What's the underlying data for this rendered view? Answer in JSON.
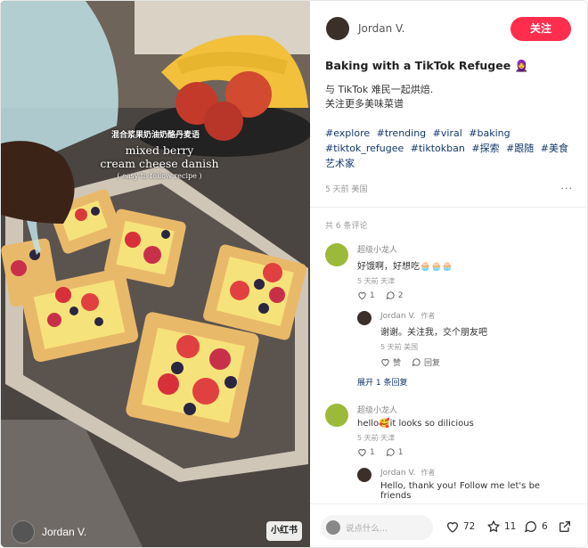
{
  "media": {
    "overlay_cn": "混合浆果奶油奶酪丹麦语",
    "overlay_title_line1": "mixed berry",
    "overlay_title_line2": "cream cheese danish",
    "overlay_subtitle": "( easy to follow recipe )",
    "author_name": "Jordan V.",
    "watermark": "小红书"
  },
  "header": {
    "author_name": "Jordan V.",
    "follow_label": "关注"
  },
  "post": {
    "title": "Baking with a TikTok Refugee 🧕",
    "desc_line1": "与 TikTok 难民一起烘焙.",
    "desc_line2": "关注更多美味菜谱",
    "tags": [
      "#explore",
      "#trending",
      "#viral",
      "#baking",
      "#tiktok_refugee",
      "#tiktokban",
      "#探索",
      "#跟随",
      "#美食艺术家"
    ],
    "time_location": "5 天前 美国",
    "more": "···"
  },
  "comments": {
    "count_label": "共 6 条评论",
    "items": [
      {
        "name": "超级小龙人",
        "text": "好饿啊，好想吃🧁🧁🧁",
        "meta": "5 天前 天津",
        "likes": "1",
        "replies": "2",
        "reply": {
          "name": "Jordan V.",
          "author_tag": "作者",
          "text": "谢谢。关注我，交个朋友吧",
          "meta": "5 天前 美国",
          "like_label": "赞",
          "reply_label": "回复"
        },
        "expand_label": "展开 1 条回复"
      },
      {
        "name": "超级小龙人",
        "text": "hello🥰it looks so dilicious",
        "meta": "5 天前 天津",
        "likes": "1",
        "replies": "1",
        "reply": {
          "name": "Jordan V.",
          "author_tag": "作者",
          "text": "Hello, thank you! Follow me let's be friends"
        }
      }
    ]
  },
  "bottom": {
    "input_placeholder": "说点什么...",
    "likes": "72",
    "stars": "11",
    "comments": "6"
  }
}
